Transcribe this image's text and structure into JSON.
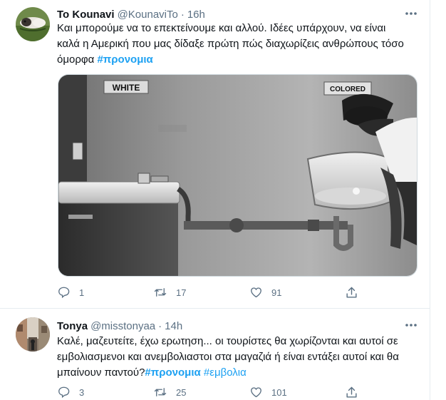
{
  "tweets": [
    {
      "display_name": "To Kounavi",
      "handle": "@KounaviTo",
      "separator": "·",
      "time": "16h",
      "text_lines": [
        "Και μπορούμε να το επεκτείνουμε και αλλού. Ιδέες υπάρχουν, να είναι",
        "καλά η Αμερική που μας δίδαξε πρώτη πώς διαχωρίζεις ανθρώπους τόσο",
        "όμορφα "
      ],
      "hashtags": [
        "#προνομια"
      ],
      "media": {
        "sign_white": "WHITE",
        "sign_colored": "COLORED"
      },
      "reply_count": "1",
      "retweet_count": "17",
      "like_count": "91"
    },
    {
      "display_name": "Tonya",
      "handle": "@misstonyaa",
      "separator": "·",
      "time": "14h",
      "text_lines": [
        "Καλέ, μαζευτείτε, έχω ερωτηση... οι τουρίστες θα χωρίζονται και αυτοί σε",
        "εμβολιασμενοι και ανεμβολιαστοι στα μαγαζιά ή είναι εντάξει αυτοί και θα",
        "μπαίνουν παντού?"
      ],
      "hashtags": [
        "#προνομια",
        "#εμβολια"
      ],
      "reply_count": "3",
      "retweet_count": "25",
      "like_count": "101"
    }
  ],
  "icons": {
    "more": "more-dots-icon",
    "reply": "reply-icon",
    "retweet": "retweet-icon",
    "like": "heart-icon",
    "share": "share-icon"
  },
  "colors": {
    "accent": "#1da1f2",
    "secondary_text": "#5b7083",
    "border": "#e6ecf0"
  }
}
